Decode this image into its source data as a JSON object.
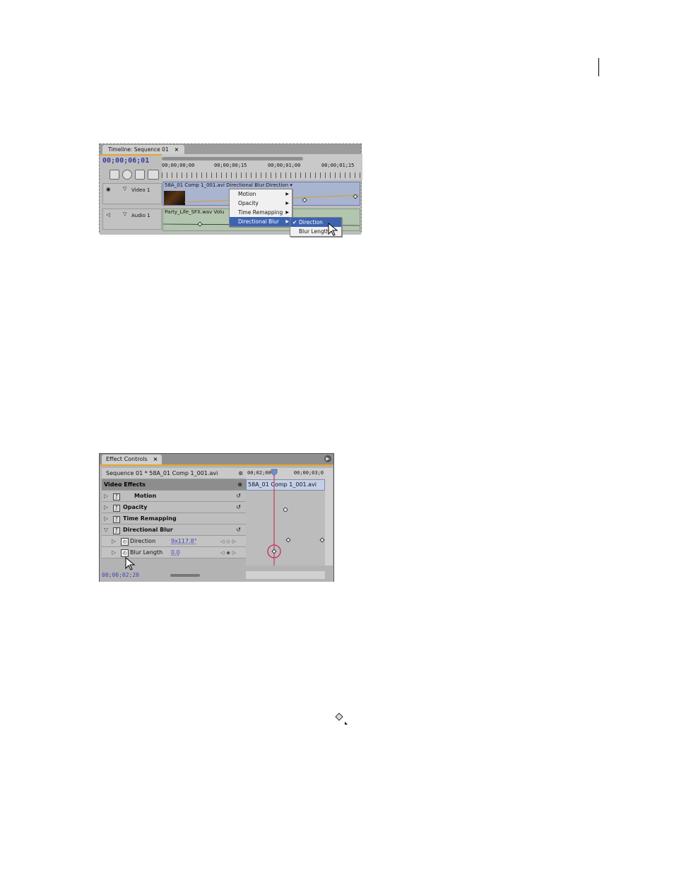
{
  "page": {
    "number": ""
  },
  "timeline": {
    "tab_label": "Timeline: Sequence 01",
    "close_label": "×",
    "timecode": "00;00;06;01",
    "ruler_labels": [
      "00;00;00;00",
      "00;00;00;15",
      "00;00;01;00",
      "00;00;01;15"
    ],
    "video_track": "Video 1",
    "audio_track": "Audio 1",
    "video_clip": "58A_01 Comp 1_001.avi  Directional Blur:Direction ▾",
    "audio_clip": "Party_Life_SFX.wav Volu",
    "menu1": [
      {
        "label": "Motion",
        "arrow": "▶"
      },
      {
        "label": "Opacity",
        "arrow": "▶"
      },
      {
        "label": "Time Remapping",
        "arrow": "▶"
      },
      {
        "label": "Directional Blur",
        "arrow": "▶"
      }
    ],
    "menu2": [
      {
        "label": "Direction",
        "check": "✔"
      },
      {
        "label": "Blur Length",
        "check": ""
      }
    ]
  },
  "effect_controls": {
    "tab_label": "Effect Controls",
    "close_label": "×",
    "sequence_label": "Sequence 01 * 58A_01 Comp 1_001.avi",
    "ruler_start": "00;02;00",
    "ruler_end": "00;00;03;0",
    "clip_name": "58A_01 Comp 1_001.avi",
    "section_header": "Video Effects",
    "effects": [
      "Motion",
      "Opacity",
      "Time Remapping",
      "Directional Blur"
    ],
    "properties": [
      {
        "name": "Direction",
        "value": "9x117.8°"
      },
      {
        "name": "Blur Length",
        "value": "0.0"
      }
    ],
    "footer_timecode": "00;00;02;20"
  },
  "colors": {
    "panel_border": "#e5a430",
    "menu_selected": "#3c63b0",
    "playhead": "#cc2244"
  }
}
